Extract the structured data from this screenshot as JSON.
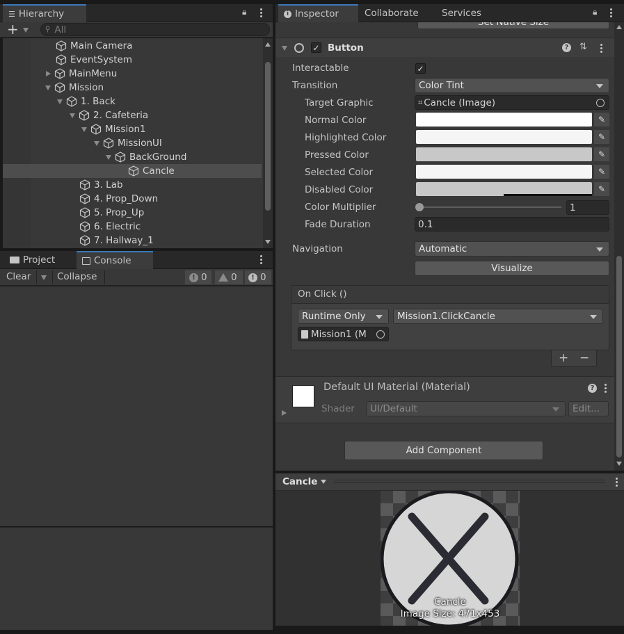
{
  "hierarchy": {
    "tab_label": "Hierarchy",
    "search_placeholder": "All",
    "items": [
      {
        "label": "Main Camera"
      },
      {
        "label": "EventSystem"
      },
      {
        "label": "MainMenu"
      },
      {
        "label": "Mission"
      },
      {
        "label": "1. Back"
      },
      {
        "label": "2. Cafeteria"
      },
      {
        "label": "Mission1"
      },
      {
        "label": "MissionUI"
      },
      {
        "label": "BackGround"
      },
      {
        "label": "Cancle"
      },
      {
        "label": "3. Lab"
      },
      {
        "label": "4. Prop_Down"
      },
      {
        "label": "5. Prop_Up"
      },
      {
        "label": "6. Electric"
      },
      {
        "label": "7. Hallway_1"
      }
    ]
  },
  "console": {
    "tabs": [
      "Project",
      "Console"
    ],
    "clear_label": "Clear",
    "collapse_label": "Collapse",
    "counts": {
      "logs": "0",
      "warnings": "0",
      "errors": "0"
    }
  },
  "inspector": {
    "tabs": [
      "Inspector",
      "Collaborate",
      "Services"
    ],
    "set_native_size": "Set Native Size",
    "component_title": "Button",
    "interactable_label": "Interactable",
    "transition_label": "Transition",
    "transition_value": "Color Tint",
    "target_graphic_label": "Target Graphic",
    "target_graphic_value": "Cancle (Image)",
    "normal_color_label": "Normal Color",
    "highlighted_color_label": "Highlighted Color",
    "pressed_color_label": "Pressed Color",
    "selected_color_label": "Selected Color",
    "disabled_color_label": "Disabled Color",
    "color_multiplier_label": "Color Multiplier",
    "color_multiplier_value": "1",
    "fade_duration_label": "Fade Duration",
    "fade_duration_value": "0.1",
    "navigation_label": "Navigation",
    "navigation_value": "Automatic",
    "visualize_label": "Visualize",
    "onclick_header": "On Click ()",
    "runtime_value": "Runtime Only",
    "function_value": "Mission1.ClickCancle",
    "object_value": "Mission1 (M",
    "plus": "+",
    "minus": "−",
    "material_title": "Default UI Material (Material)",
    "shader_label": "Shader",
    "shader_value": "UI/Default",
    "edit_label": "Edit...",
    "add_component": "Add Component",
    "colors": {
      "normal": "#ffffff",
      "highlighted": "#f5f5f5",
      "pressed": "#c8c8c8",
      "selected": "#f5f5f5",
      "disabled": "#c8c8c8"
    }
  },
  "preview": {
    "title": "Cancle",
    "caption_name": "Cancle",
    "caption_size": "Image Size: 471x453"
  }
}
